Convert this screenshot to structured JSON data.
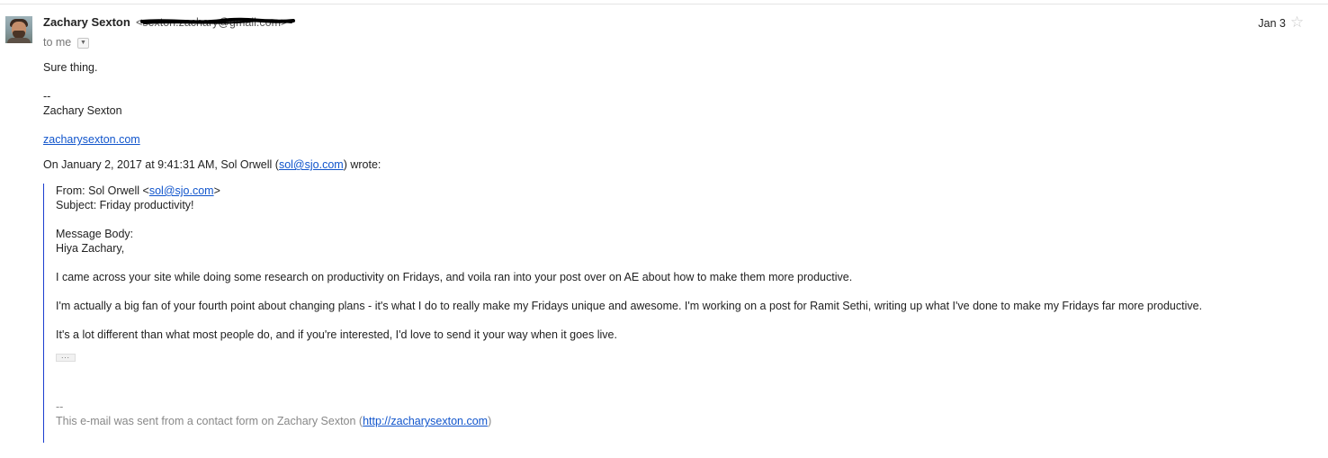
{
  "message": {
    "sender_name": "Zachary Sexton",
    "sender_email": "<sexton.zachary@gmail.com>",
    "recipient": "to me",
    "date": "Jan 3",
    "reply_text": "Sure thing.",
    "signature": {
      "separator": "--",
      "name": "Zachary Sexton",
      "site": "zacharysexton.com"
    },
    "attribution": {
      "prefix": "On January 2, 2017 at 9:41:31 AM, Sol Orwell (",
      "email": "sol@sjo.com",
      "suffix": ") wrote:"
    },
    "quoted": {
      "from_label": "From: Sol Orwell <",
      "from_email": "sol@sjo.com",
      "from_close": ">",
      "subject": "Subject: Friday productivity!",
      "body_label": "Message Body:",
      "greeting": "Hiya Zachary,",
      "paragraphs": [
        "I came across your site while doing some research on productivity on Fridays, and voila ran into your post over on AE about how to make them more productive.",
        "I'm actually a big fan of your fourth point about changing plans - it's what I do to really make my Fridays unique and awesome. I'm working on a post for Ramit Sethi, writing up what I've done to make my Fridays far more productive.",
        "It's a lot different than what most people do, and if you're interested, I'd love to send it your way when it goes live."
      ],
      "expand_label": "...",
      "footer_separator": "--",
      "footer_prefix": "This e-mail was sent from a contact form on Zachary Sexton (",
      "footer_link": "http://zacharysexton.com",
      "footer_suffix": ")"
    }
  }
}
